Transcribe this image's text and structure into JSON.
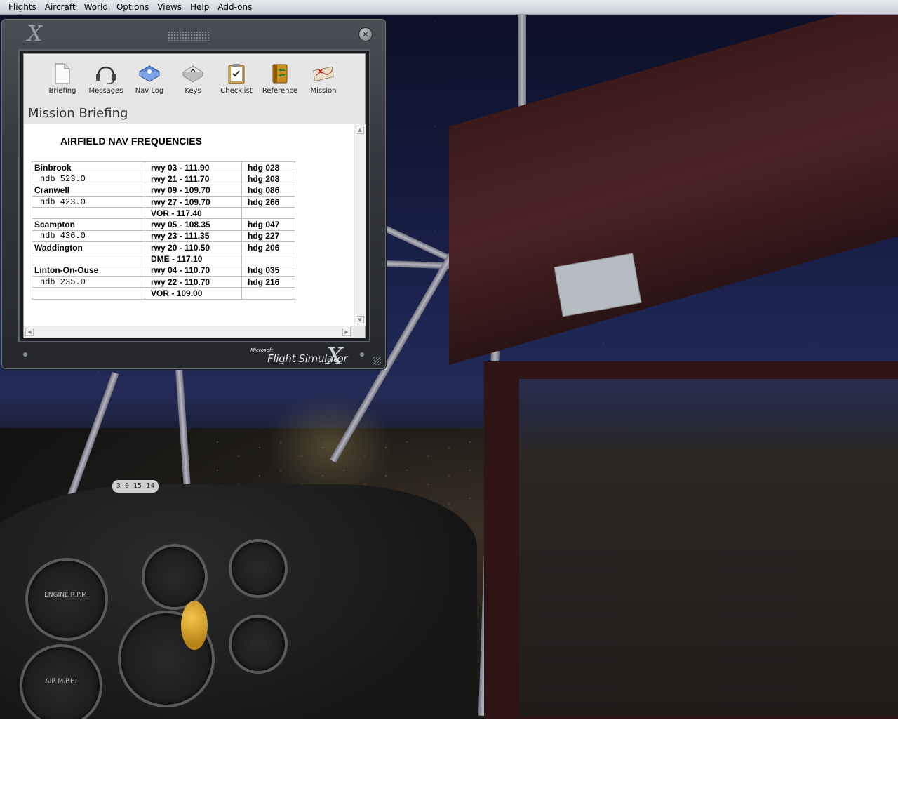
{
  "menu": {
    "items": [
      {
        "id": "flights",
        "label": "Flights"
      },
      {
        "id": "aircraft",
        "label": "Aircraft"
      },
      {
        "id": "world",
        "label": "World"
      },
      {
        "id": "options",
        "label": "Options"
      },
      {
        "id": "views",
        "label": "Views"
      },
      {
        "id": "help",
        "label": "Help"
      },
      {
        "id": "addons",
        "label": "Add-ons"
      }
    ]
  },
  "kneeboard": {
    "logo": "X",
    "close_glyph": "✕",
    "toolbar": [
      {
        "id": "briefing",
        "label": "Briefing",
        "icon": "document-icon"
      },
      {
        "id": "messages",
        "label": "Messages",
        "icon": "headset-icon"
      },
      {
        "id": "navlog",
        "label": "Nav Log",
        "icon": "nav-log-icon"
      },
      {
        "id": "keys",
        "label": "Keys",
        "icon": "key-icon"
      },
      {
        "id": "checklist",
        "label": "Checklist",
        "icon": "clipboard-icon"
      },
      {
        "id": "reference",
        "label": "Reference",
        "icon": "binder-icon"
      },
      {
        "id": "mission",
        "label": "Mission",
        "icon": "map-icon"
      }
    ],
    "section_title": "Mission Briefing",
    "content": {
      "heading": "AIRFIELD NAV FREQUENCIES",
      "rows": [
        {
          "name": "Binbrook",
          "runway": "rwy 03 - 111.90",
          "heading": "hdg 028",
          "ndb": false
        },
        {
          "name": "ndb 523.0",
          "runway": "rwy 21 - 111.70",
          "heading": "hdg 208",
          "ndb": true
        },
        {
          "name": "Cranwell",
          "runway": "rwy 09 - 109.70",
          "heading": "hdg 086",
          "ndb": false
        },
        {
          "name": "ndb 423.0",
          "runway": "rwy 27 - 109.70",
          "heading": "hdg 266",
          "ndb": true
        },
        {
          "name": "",
          "runway": "VOR - 117.40",
          "heading": "",
          "ndb": false
        },
        {
          "name": "Scampton",
          "runway": "rwy 05 - 108.35",
          "heading": "hdg 047",
          "ndb": false
        },
        {
          "name": "ndb 436.0",
          "runway": "rwy 23 - 111.35",
          "heading": "hdg 227",
          "ndb": true
        },
        {
          "name": "Waddington",
          "runway": "rwy 20 - 110.50",
          "heading": "hdg 206",
          "ndb": false
        },
        {
          "name": "",
          "runway": "DME - 117.10",
          "heading": "",
          "ndb": false
        },
        {
          "name": "Linton-On-Ouse",
          "runway": "rwy 04 - 110.70",
          "heading": "hdg 035",
          "ndb": false
        },
        {
          "name": "ndb 235.0",
          "runway": "rwy 22 - 110.70",
          "heading": "hdg 216",
          "ndb": true
        },
        {
          "name": "",
          "runway": "VOR - 109.00",
          "heading": "",
          "ndb": false
        }
      ]
    },
    "brand": {
      "maker": "Microsoft",
      "product": "Flight Simulator",
      "mark": "X"
    }
  },
  "instruments": {
    "engine_gauge": "ENGINE R.P.M.",
    "air_gauge": "AIR M.P.H.",
    "compass_readout": "3 0 15 14 18"
  }
}
